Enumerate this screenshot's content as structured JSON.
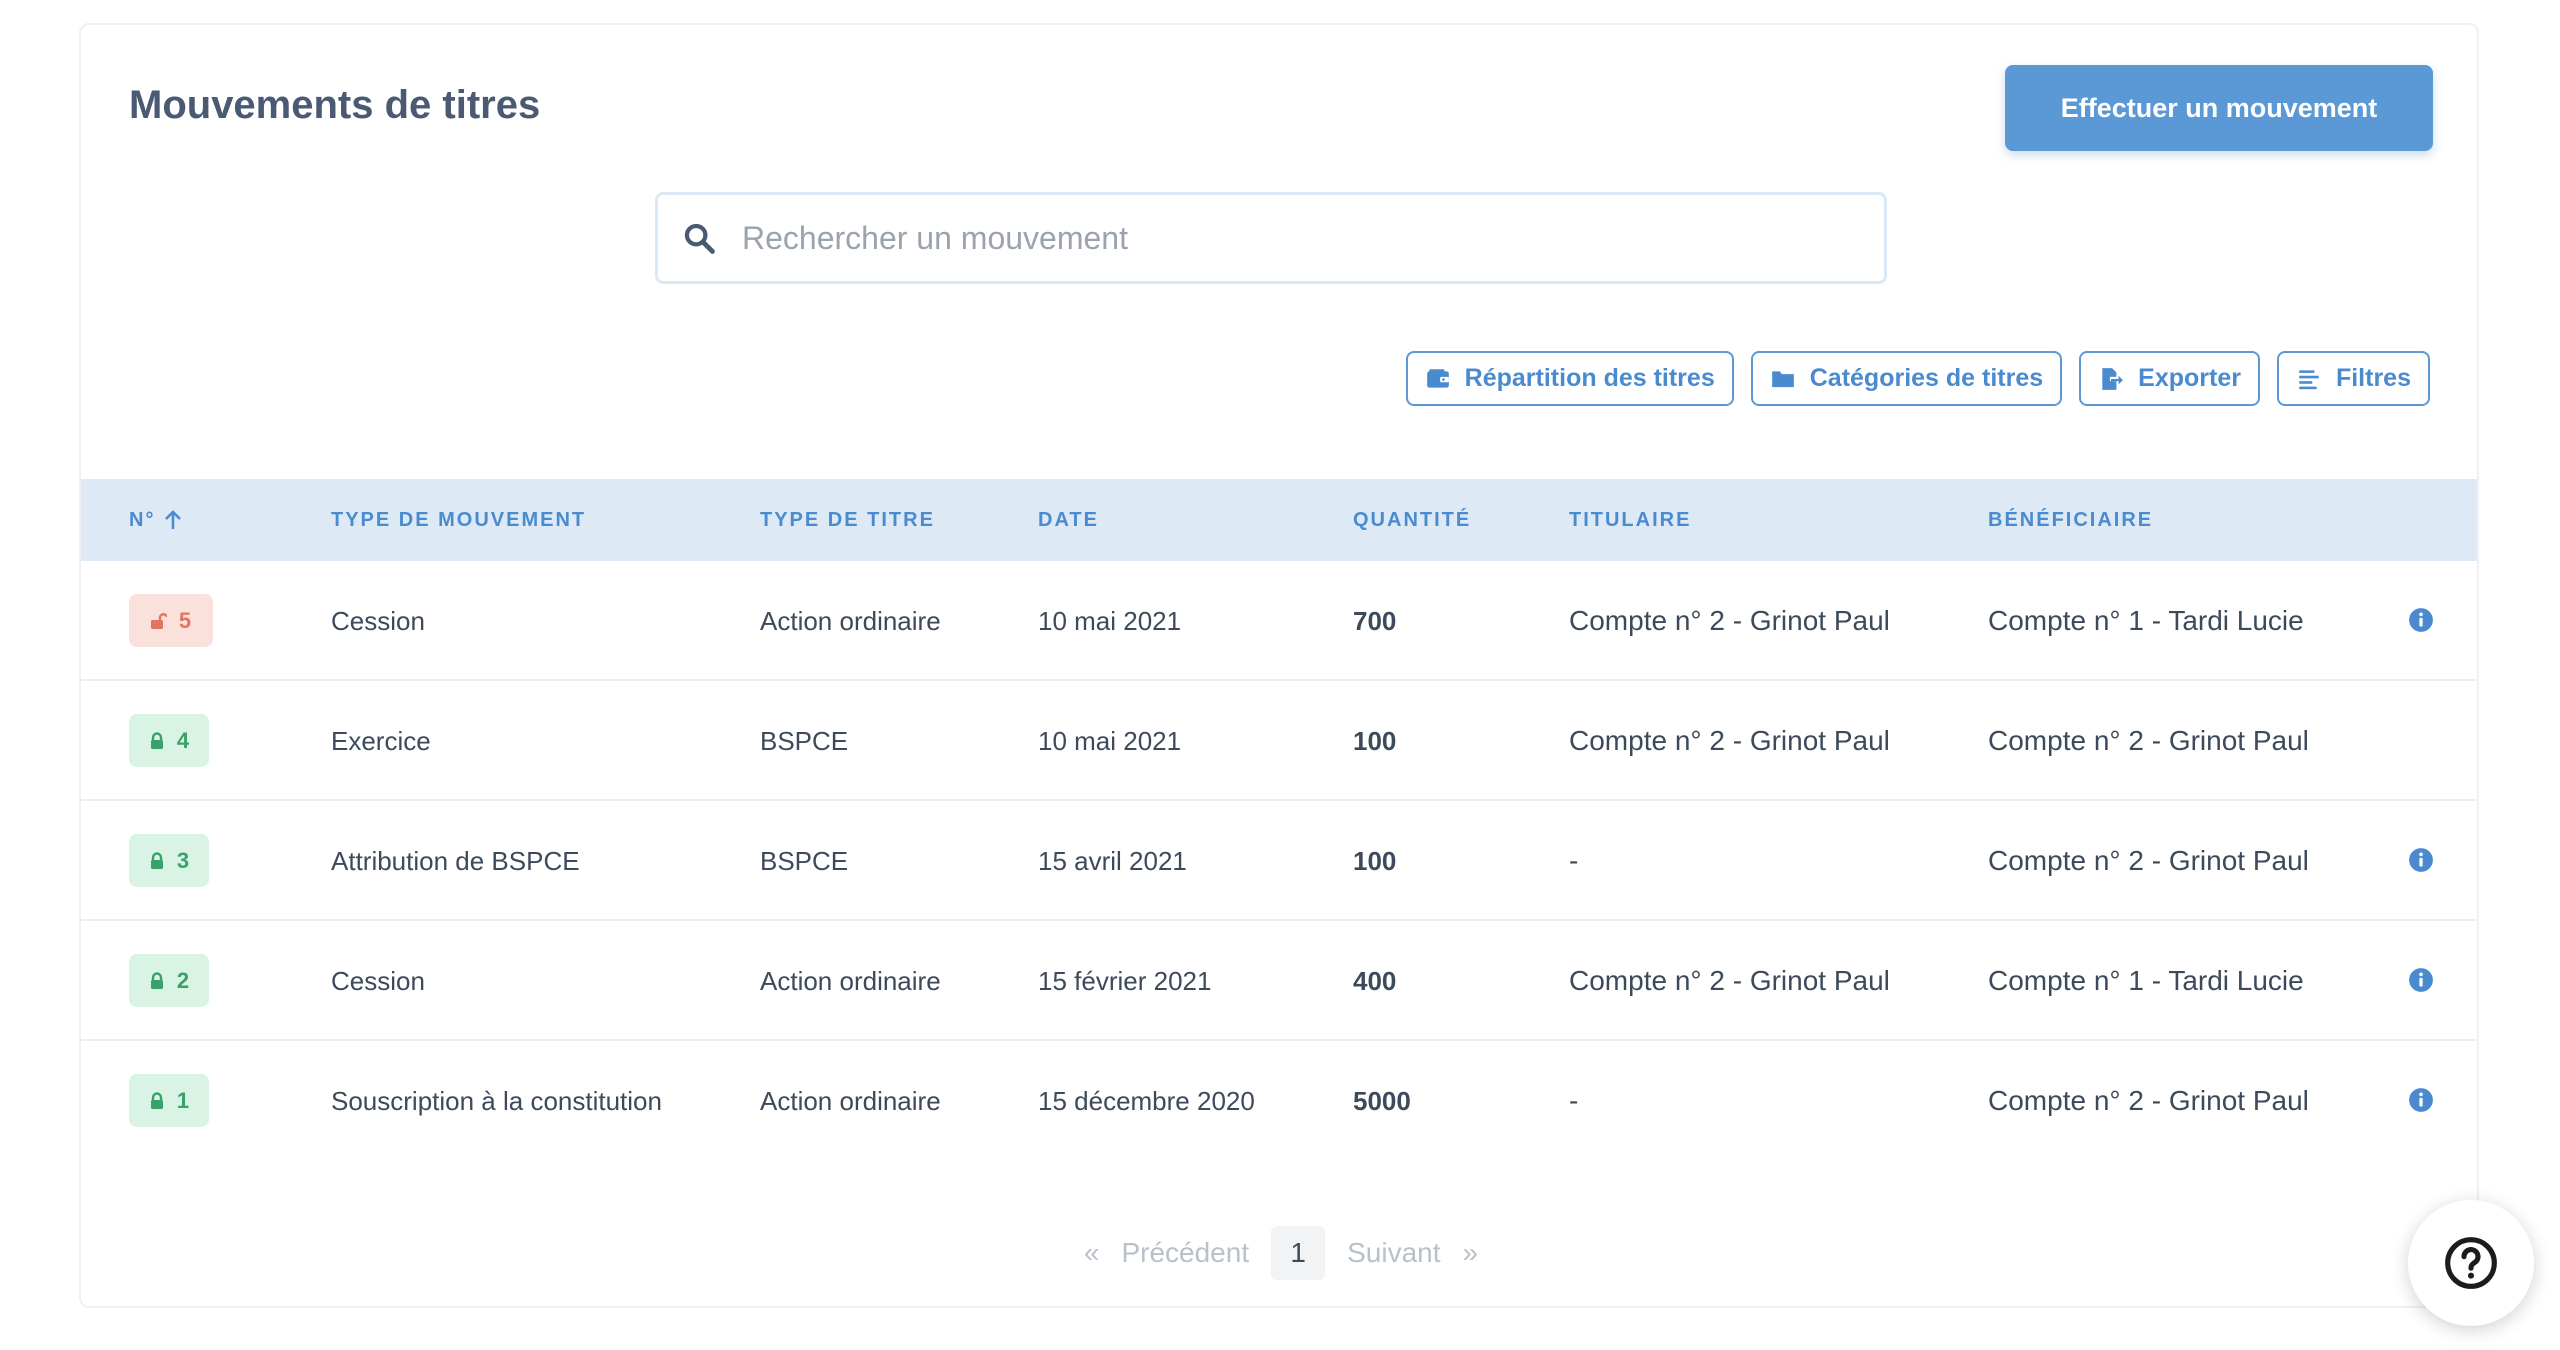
{
  "header": {
    "title": "Mouvements de titres",
    "primary_action": "Effectuer un mouvement"
  },
  "search": {
    "placeholder": "Rechercher un mouvement",
    "value": ""
  },
  "toolbar": {
    "repartition": "Répartition des titres",
    "categories": "Catégories de titres",
    "export": "Exporter",
    "filters": "Filtres"
  },
  "table": {
    "columns": {
      "num": "N°",
      "type_mouvement": "Type de mouvement",
      "type_titre": "Type de titre",
      "date": "Date",
      "quantite": "Quantité",
      "titulaire": "Titulaire",
      "beneficiaire": "Bénéficiaire"
    },
    "sort": "ascending",
    "rows": [
      {
        "num": "5",
        "locked": false,
        "type_mouvement": "Cession",
        "type_titre": "Action ordinaire",
        "date": "10 mai 2021",
        "quantite": "700",
        "titulaire": "Compte n° 2 - Grinot Paul",
        "beneficiaire": "Compte n° 1 - Tardi Lucie",
        "info": true
      },
      {
        "num": "4",
        "locked": true,
        "type_mouvement": "Exercice",
        "type_titre": "BSPCE",
        "date": "10 mai 2021",
        "quantite": "100",
        "titulaire": "Compte n° 2 - Grinot Paul",
        "beneficiaire": "Compte n° 2 - Grinot Paul",
        "info": false
      },
      {
        "num": "3",
        "locked": true,
        "type_mouvement": "Attribution de BSPCE",
        "type_titre": "BSPCE",
        "date": "15 avril 2021",
        "quantite": "100",
        "titulaire": "-",
        "beneficiaire": "Compte n° 2 - Grinot Paul",
        "info": true
      },
      {
        "num": "2",
        "locked": true,
        "type_mouvement": "Cession",
        "type_titre": "Action ordinaire",
        "date": "15 février 2021",
        "quantite": "400",
        "titulaire": "Compte n° 2 - Grinot Paul",
        "beneficiaire": "Compte n° 1 - Tardi Lucie",
        "info": true
      },
      {
        "num": "1",
        "locked": true,
        "type_mouvement": "Souscription à la constitution",
        "type_titre": "Action ordinaire",
        "date": "15 décembre 2020",
        "quantite": "5000",
        "titulaire": "-",
        "beneficiaire": "Compte n° 2 - Grinot Paul",
        "info": true
      }
    ]
  },
  "pagination": {
    "first": "«",
    "prev": "Précédent",
    "current": "1",
    "next": "Suivant",
    "last": "»"
  },
  "icons": {
    "search": "search-icon",
    "wallet": "wallet-icon",
    "folder": "folder-icon",
    "export": "file-export-icon",
    "filters": "filter-lines-icon",
    "sort": "arrow-up-icon",
    "lock": "lock-icon",
    "unlock": "unlock-icon",
    "info": "info-icon",
    "help": "question-icon"
  },
  "colors": {
    "accent": "#5b99d6",
    "header_bg": "#dde9f5",
    "locked_badge": "#d9f3e4",
    "unlocked_badge": "#fbe1dc"
  }
}
